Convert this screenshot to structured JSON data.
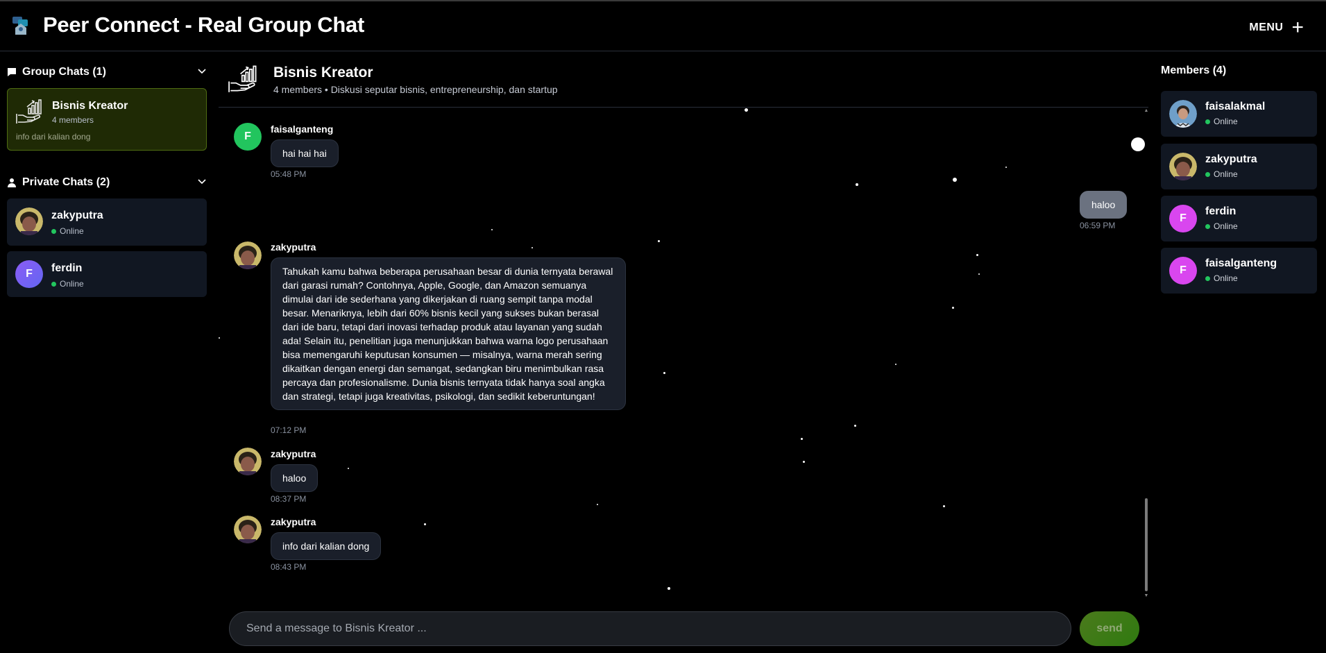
{
  "app": {
    "title": "Peer Connect - Real Group Chat",
    "menu_label": "MENU"
  },
  "sidebar": {
    "group_section": {
      "title": "Group Chats (1)",
      "items": [
        {
          "name": "Bisnis Kreator",
          "members": "4 members",
          "last_message": "info dari kalian dong"
        }
      ]
    },
    "private_section": {
      "title": "Private Chats (2)",
      "items": [
        {
          "name": "zakyputra",
          "status": "Online"
        },
        {
          "name": "ferdin",
          "status": "Online",
          "initial": "F"
        }
      ]
    }
  },
  "chat": {
    "title": "Bisnis Kreator",
    "subtitle": "4 members • Diskusi seputar bisnis, entrepreneurship, dan startup",
    "messages": [
      {
        "sender": "faisalganteng",
        "initial": "F",
        "text": "hai hai hai",
        "time": "05:48 PM"
      },
      {
        "own": true,
        "text": "haloo",
        "time": "06:59 PM"
      },
      {
        "sender": "zakyputra",
        "text": "Tahukah kamu bahwa beberapa perusahaan besar di dunia ternyata berawal dari garasi rumah? Contohnya, Apple, Google, dan Amazon semuanya dimulai dari ide sederhana yang dikerjakan di ruang sempit tanpa modal besar. Menariknya, lebih dari 60% bisnis kecil yang sukses bukan berasal dari ide baru, tetapi dari inovasi terhadap produk atau layanan yang sudah ada! Selain itu, penelitian juga menunjukkan bahwa warna logo perusahaan bisa memengaruhi keputusan konsumen — misalnya, warna merah sering dikaitkan dengan energi dan semangat, sedangkan biru menimbulkan rasa percaya dan profesionalisme. Dunia bisnis ternyata tidak hanya soal angka dan strategi, tetapi juga kreativitas, psikologi, dan sedikit keberuntungan!",
        "time": "07:12 PM"
      },
      {
        "sender": "zakyputra",
        "text": "haloo",
        "time": "08:37 PM"
      },
      {
        "sender": "zakyputra",
        "text": "info dari kalian dong",
        "time": "08:43 PM"
      }
    ],
    "input_placeholder": "Send a message to Bisnis Kreator ...",
    "send_label": "send"
  },
  "members": {
    "title": "Members (4)",
    "items": [
      {
        "name": "faisalakmal",
        "status": "Online"
      },
      {
        "name": "zakyputra",
        "status": "Online"
      },
      {
        "name": "ferdin",
        "status": "Online",
        "initial": "F"
      },
      {
        "name": "faisalganteng",
        "status": "Online",
        "initial": "F"
      }
    ]
  },
  "colors": {
    "accent_green": "#4f6d12",
    "online": "#22c55e",
    "avatar_green": "#22c55e",
    "avatar_purple": "#8b5cf6",
    "avatar_magenta": "#d946ef"
  }
}
